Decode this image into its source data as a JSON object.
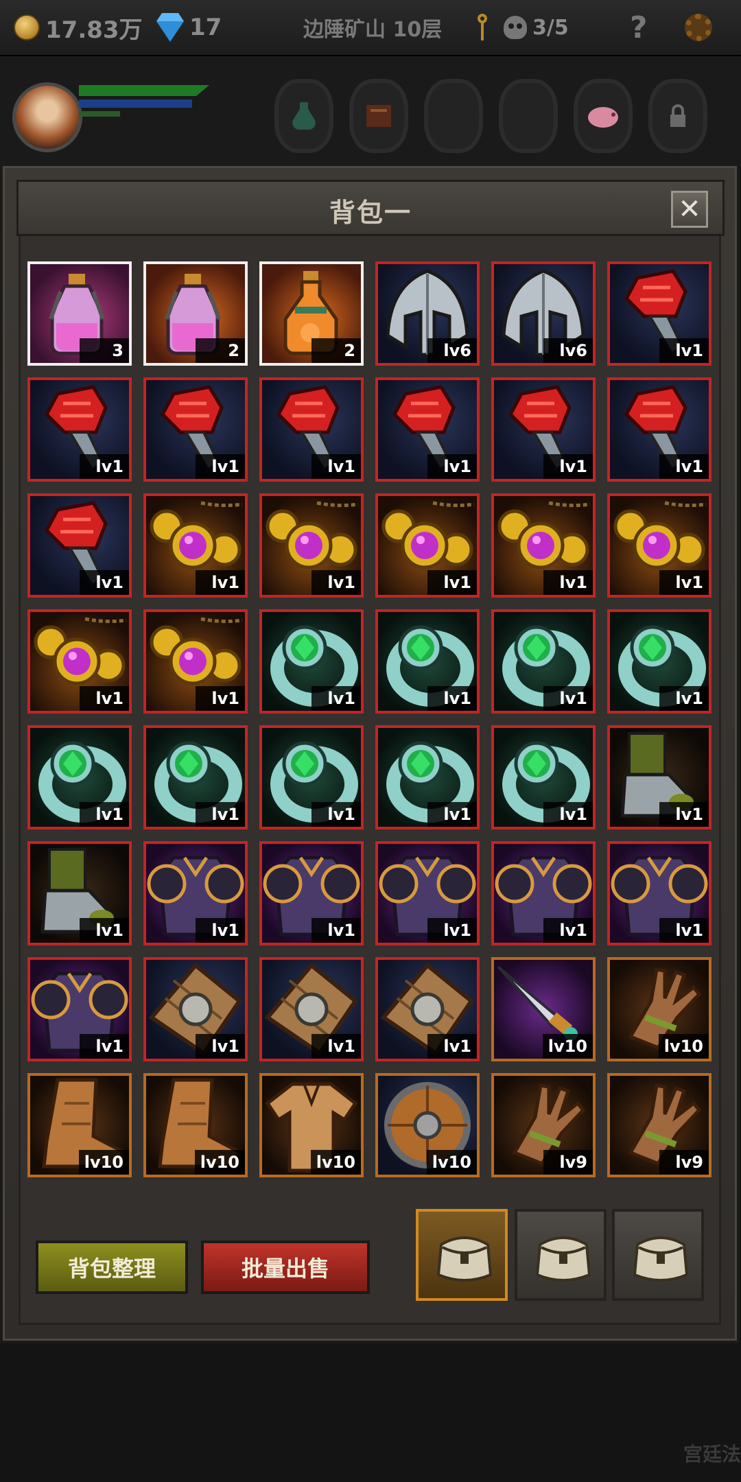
{
  "topbar": {
    "gold": "17.83万",
    "gems": "17",
    "location": "边陲矿山 10层",
    "kills": "3/5",
    "help": "?"
  },
  "panel": {
    "title": "背包一",
    "close": "✕"
  },
  "actions": {
    "sort_label": "背包整理",
    "sell_label": "批量出售"
  },
  "bag_tabs": [
    {
      "name": "bag-1",
      "active": true
    },
    {
      "name": "bag-2",
      "active": false
    },
    {
      "name": "bag-3",
      "active": false
    }
  ],
  "corner_text": "宫廷法",
  "items": [
    {
      "type": "potion-pink",
      "label": "3",
      "quality": "white"
    },
    {
      "type": "potion-pink-orange",
      "label": "2",
      "quality": "white"
    },
    {
      "type": "potion-orange",
      "label": "2",
      "quality": "white"
    },
    {
      "type": "helmet",
      "label": "lv6",
      "quality": "red"
    },
    {
      "type": "helmet",
      "label": "lv6",
      "quality": "red"
    },
    {
      "type": "gauntlet",
      "label": "lv1",
      "quality": "red"
    },
    {
      "type": "gauntlet",
      "label": "lv1",
      "quality": "red"
    },
    {
      "type": "gauntlet",
      "label": "lv1",
      "quality": "red"
    },
    {
      "type": "gauntlet",
      "label": "lv1",
      "quality": "red"
    },
    {
      "type": "gauntlet",
      "label": "lv1",
      "quality": "red"
    },
    {
      "type": "gauntlet",
      "label": "lv1",
      "quality": "red"
    },
    {
      "type": "gauntlet",
      "label": "lv1",
      "quality": "red"
    },
    {
      "type": "gauntlet",
      "label": "lv1",
      "quality": "red"
    },
    {
      "type": "amulet",
      "label": "lv1",
      "quality": "red"
    },
    {
      "type": "amulet",
      "label": "lv1",
      "quality": "red"
    },
    {
      "type": "amulet",
      "label": "lv1",
      "quality": "red"
    },
    {
      "type": "amulet",
      "label": "lv1",
      "quality": "red"
    },
    {
      "type": "amulet",
      "label": "lv1",
      "quality": "red"
    },
    {
      "type": "amulet",
      "label": "lv1",
      "quality": "red"
    },
    {
      "type": "amulet",
      "label": "lv1",
      "quality": "red"
    },
    {
      "type": "ring",
      "label": "lv1",
      "quality": "red"
    },
    {
      "type": "ring",
      "label": "lv1",
      "quality": "red"
    },
    {
      "type": "ring",
      "label": "lv1",
      "quality": "red"
    },
    {
      "type": "ring",
      "label": "lv1",
      "quality": "red"
    },
    {
      "type": "ring",
      "label": "lv1",
      "quality": "red"
    },
    {
      "type": "ring",
      "label": "lv1",
      "quality": "red"
    },
    {
      "type": "ring",
      "label": "lv1",
      "quality": "red"
    },
    {
      "type": "ring",
      "label": "lv1",
      "quality": "red"
    },
    {
      "type": "ring",
      "label": "lv1",
      "quality": "red"
    },
    {
      "type": "boots-plate",
      "label": "lv1",
      "quality": "red"
    },
    {
      "type": "boots-plate",
      "label": "lv1",
      "quality": "red"
    },
    {
      "type": "armor",
      "label": "lv1",
      "quality": "red"
    },
    {
      "type": "armor",
      "label": "lv1",
      "quality": "red"
    },
    {
      "type": "armor",
      "label": "lv1",
      "quality": "red"
    },
    {
      "type": "armor",
      "label": "lv1",
      "quality": "red"
    },
    {
      "type": "armor",
      "label": "lv1",
      "quality": "red"
    },
    {
      "type": "armor",
      "label": "lv1",
      "quality": "red"
    },
    {
      "type": "shield-square",
      "label": "lv1",
      "quality": "red"
    },
    {
      "type": "shield-square",
      "label": "lv1",
      "quality": "red"
    },
    {
      "type": "shield-square",
      "label": "lv1",
      "quality": "red"
    },
    {
      "type": "dagger",
      "label": "lv10",
      "quality": "orange"
    },
    {
      "type": "gloves",
      "label": "lv10",
      "quality": "orange"
    },
    {
      "type": "boots-leather",
      "label": "lv10",
      "quality": "orange"
    },
    {
      "type": "boots-leather",
      "label": "lv10",
      "quality": "orange"
    },
    {
      "type": "shirt",
      "label": "lv10",
      "quality": "orange"
    },
    {
      "type": "shield-round",
      "label": "lv10",
      "quality": "orange"
    },
    {
      "type": "gloves",
      "label": "lv9",
      "quality": "orange"
    },
    {
      "type": "gloves",
      "label": "lv9",
      "quality": "orange"
    }
  ]
}
